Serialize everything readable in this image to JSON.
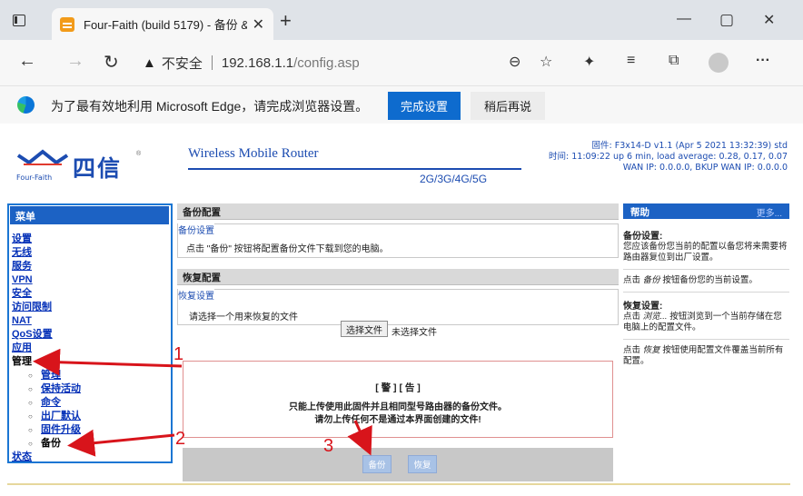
{
  "browser": {
    "tab_title": "Four-Faith (build 5179) - 备份 &",
    "tab_close": "✕",
    "new_tab": "+",
    "window_min": "—",
    "window_max": "▢",
    "window_close": "✕",
    "back": "←",
    "forward": "→",
    "refresh": "↻",
    "insecure_label": "不安全",
    "url_host": "192.168.1.1",
    "url_path": "/config.asp",
    "icons": {
      "zoom": "⊖",
      "favorites_add": "☆",
      "extensions": "✦",
      "favorites": "≡",
      "collections": "⧉",
      "more": "···"
    }
  },
  "infobar": {
    "message": "为了最有效地利用 Microsoft Edge，请完成浏览器设置。",
    "primary_button": "完成设置",
    "secondary_button": "稍后再说"
  },
  "router": {
    "brand_cn": "四信",
    "brand_en": "Four-Faith",
    "brand_reg": "®",
    "product_title": "Wireless Mobile Router",
    "band": "2G/3G/4G/5G",
    "firmware_line": "固件: F3x14-D v1.1 (Apr 5 2021 13:32:39) std",
    "time_line": "时间: 11:09:22 up 6 min, load average: 0.28, 0.17, 0.07",
    "wan_line": "WAN IP: 0.0.0.0, BKUP WAN IP: 0.0.0.0"
  },
  "sidebar": {
    "header": "菜单",
    "items": [
      {
        "label": "设置",
        "link": true
      },
      {
        "label": "无线",
        "link": true
      },
      {
        "label": "服务",
        "link": true
      },
      {
        "label": "VPN",
        "link": true
      },
      {
        "label": "安全",
        "link": true
      },
      {
        "label": "访问限制",
        "link": true
      },
      {
        "label": "NAT",
        "link": true
      },
      {
        "label": "QoS设置",
        "link": true
      },
      {
        "label": "应用",
        "link": true
      },
      {
        "label": "管理",
        "link": false
      }
    ],
    "subitems": [
      {
        "label": "管理",
        "link": true
      },
      {
        "label": "保持活动",
        "link": true
      },
      {
        "label": "命令",
        "link": true
      },
      {
        "label": "出厂默认",
        "link": true
      },
      {
        "label": "固件升级",
        "link": true
      },
      {
        "label": "备份",
        "link": false
      }
    ],
    "last_item": "状态"
  },
  "main": {
    "backup_section": "备份配置",
    "backup_legend": "备份设置",
    "backup_desc": "点击 \"备份\" 按钮将配置备份文件下载到您的电脑。",
    "restore_section": "恢复配置",
    "restore_legend": "恢复设置",
    "restore_desc": "请选择一个用来恢复的文件",
    "choose_file": "选择文件",
    "no_file": "未选择文件",
    "warning_title": "[ 警 ] [ 告 ]",
    "warning_line1": "只能上传使用此固件并且相同型号路由器的备份文件。",
    "warning_line2": "请勿上传任何不是通过本界面创建的文件!",
    "backup_button": "备份",
    "restore_button": "恢复"
  },
  "help": {
    "header": "帮助",
    "more": "更多...",
    "backup_title": "备份设置:",
    "backup_text": "您应该备份您当前的配置以备您将来需要将路由器复位到出厂设置。",
    "backup_click_pre": "点击",
    "backup_click_em": "备份",
    "backup_click_post": "按钮备份您的当前设置。",
    "restore_title": "恢复设置:",
    "restore_text_pre": "点击",
    "restore_text_em": "浏览...",
    "restore_text_post": "按钮浏览到一个当前存储在您电脑上的配置文件。",
    "restore_click_pre": "点击",
    "restore_click_em": "恢复",
    "restore_click_post": "按钮使用配置文件覆盖当前所有配置。"
  },
  "annotations": {
    "step1": "1",
    "step2": "2",
    "step3": "3",
    "color": "#d8141b"
  }
}
